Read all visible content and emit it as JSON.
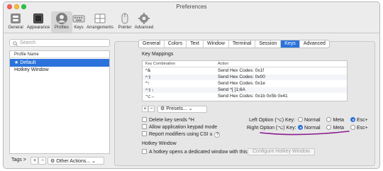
{
  "window": {
    "title": "Preferences"
  },
  "toolbar": {
    "items": [
      {
        "label": "General",
        "icon": "toggle-switch-icon"
      },
      {
        "label": "Appearance",
        "icon": "appearance-icon"
      },
      {
        "label": "Profiles",
        "icon": "person-icon",
        "active": true
      },
      {
        "label": "Keys",
        "icon": "keyboard-icon"
      },
      {
        "label": "Arrangements",
        "icon": "window-grid-icon"
      },
      {
        "label": "Pointer",
        "icon": "mouse-icon"
      },
      {
        "label": "Advanced",
        "icon": "gear-icon"
      }
    ]
  },
  "sidebar": {
    "search_placeholder": "Search",
    "list_header": "Profile Name",
    "profiles": [
      {
        "name": "Default",
        "selected": true,
        "starred": true
      },
      {
        "name": "Hotkey Window",
        "selected": false,
        "starred": false
      }
    ],
    "tags_label": "Tags >",
    "plus": "+",
    "minus": "−",
    "other_actions": "Other Actions..."
  },
  "tabs": [
    "General",
    "Colors",
    "Text",
    "Window",
    "Terminal",
    "Session",
    "Keys",
    "Advanced"
  ],
  "active_tab": "Keys",
  "key_mappings": {
    "title": "Key Mappings",
    "col_combination": "Key Combination",
    "col_action": "Action",
    "rows": [
      {
        "key": "^&",
        "action": "Send Hex Codes: 0x1f"
      },
      {
        "key": "^⇧",
        "action": "Send Hex Codes: 0x00"
      },
      {
        "key": "^↑",
        "action": "Send Hex Codes: 0x1e"
      },
      {
        "key": "^⇧↑",
        "action": "Send ^[ [1;6A"
      },
      {
        "key": "⌥←",
        "action": "Send Hex Codes: 0x1b 0x5b 0x41"
      }
    ],
    "plus": "+",
    "minus": "−",
    "presets": "Presets..."
  },
  "options": {
    "delete_sends": "Delete key sends ^H",
    "allow_keypad": "Allow application keypad mode",
    "report_modifiers": "Report modifiers using CSI u",
    "help": "?",
    "left_option_label": "Left Option (⌥) Key:",
    "right_option_label": "Right Option (⌥) Key:",
    "choices": [
      "Normal",
      "Meta",
      "Esc+"
    ],
    "left_selected": "Esc+",
    "right_selected": "Normal"
  },
  "hotkey": {
    "title": "Hotkey Window",
    "checkbox_label": "A hotkey opens a dedicated window with this profile.",
    "configure_button": "Configure Hotkey Window"
  },
  "colors": {
    "accent": "#2b73db",
    "annotation": "#8a1a8e"
  }
}
